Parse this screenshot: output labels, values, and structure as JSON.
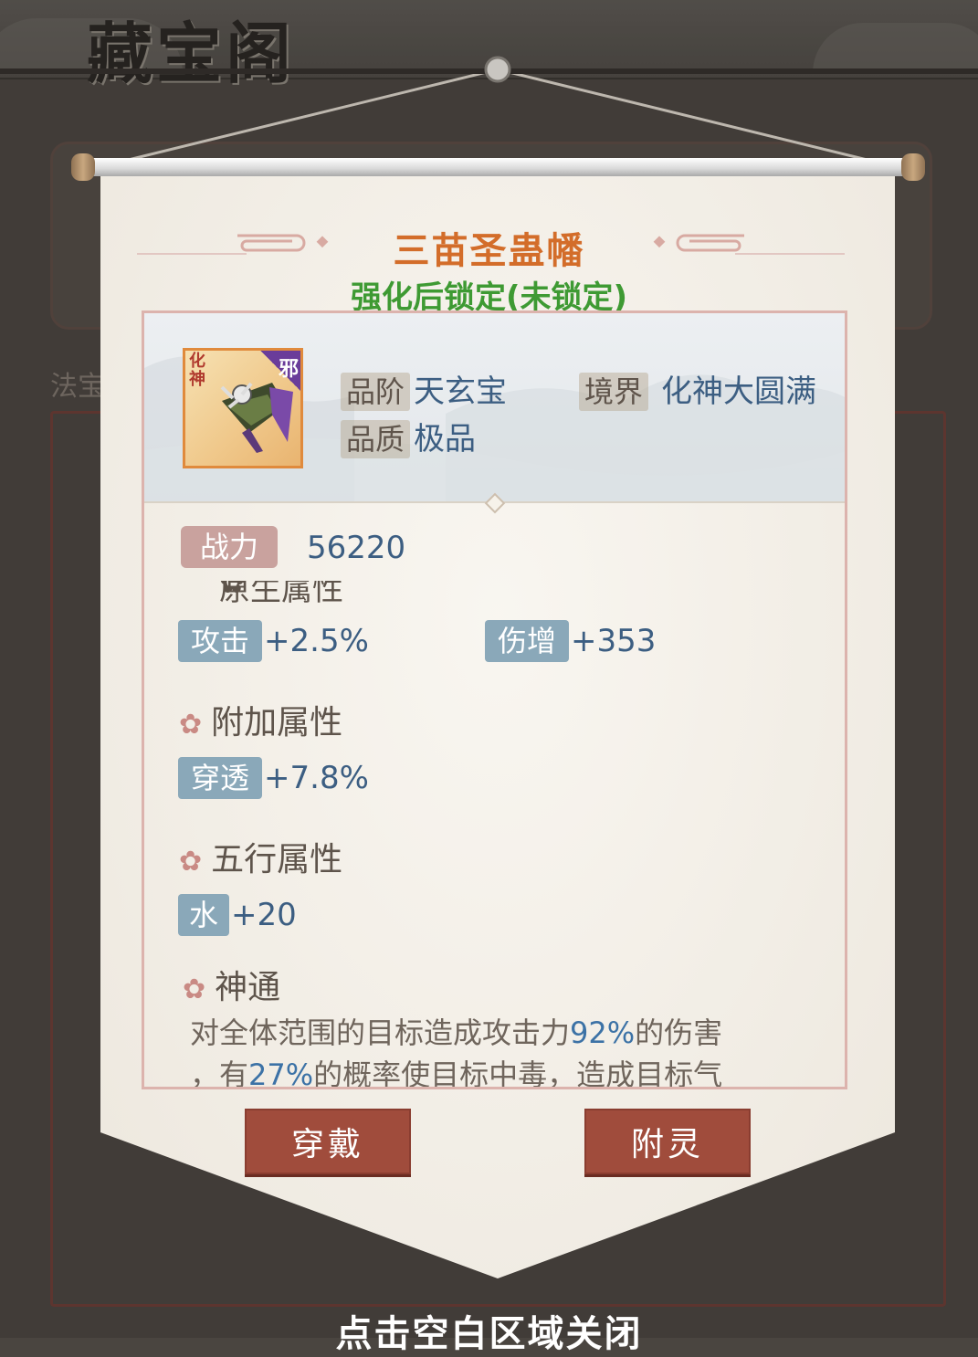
{
  "background": {
    "shop_title": "藏宝阁",
    "tab_label": "法宝"
  },
  "item": {
    "name": "三苗圣蛊幡",
    "lock_status": "强化后锁定(未锁定)",
    "icon": {
      "realm_badge": "化神",
      "type_badge": "邪",
      "art": "banner-weapon-icon"
    },
    "attributes": {
      "grade_label": "品阶",
      "grade_value": "天玄宝",
      "realm_label": "境界",
      "realm_value": "化神大圆满",
      "quality_label": "品质",
      "quality_value": "极品"
    },
    "power_label": "战力",
    "power_value": "56220",
    "base_section": {
      "title": "原生属性",
      "stats": [
        {
          "label": "攻击",
          "value": "+2.5%"
        },
        {
          "label": "伤增",
          "value": "+353"
        }
      ]
    },
    "extra_section": {
      "title": "附加属性",
      "stats": [
        {
          "label": "穿透",
          "value": "+7.8%"
        }
      ]
    },
    "element_section": {
      "title": "五行属性",
      "stats": [
        {
          "label": "水",
          "value": "+20"
        }
      ]
    },
    "skill_section": {
      "title": "神通",
      "line1_a": "对全体范围的目标造成攻击力",
      "line1_b": "92%",
      "line1_c": "的伤害",
      "line2_a": "，有",
      "line2_b": "27%",
      "line2_c": "的概率使目标中毒，造成目标气"
    }
  },
  "buttons": {
    "equip": "穿戴",
    "enchant": "附灵"
  },
  "close_hint": "点击空白区域关闭",
  "colors": {
    "title": "#d36d2a",
    "lock_status": "#3e9a33",
    "value_blue": "#3c5e82",
    "button_red": "#a04c3c",
    "stat_tag": "#8aa8b9",
    "power_tag": "#c9a29e"
  }
}
